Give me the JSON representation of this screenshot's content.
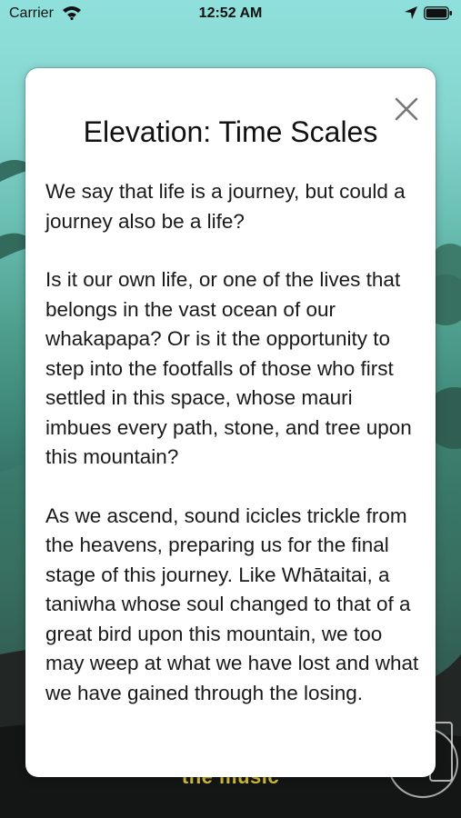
{
  "status_bar": {
    "carrier": "Carrier",
    "time": "12:52 AM",
    "icons": [
      "wifi-icon",
      "location-arrow-icon",
      "battery-icon"
    ]
  },
  "background": {
    "caption": "the music",
    "caption_color": "#d9c23a"
  },
  "modal": {
    "title": "Elevation: Time Scales",
    "close_icon": "close-icon",
    "paragraphs": [
      "We say that life is a journey, but could a journey also be a life?",
      "Is it our own life, or one of the lives that belongs in the vast ocean of our whakapapa? Or is it the opportunity to step into the footfalls of those who first settled in this space, whose mauri imbues every path, stone, and tree upon this mountain?",
      "As we ascend, sound icicles trickle from the heavens, preparing us for the final stage of this journey. Like Whātaitai, a taniwha whose soul changed to that of a great bird upon this mountain, we too may weep at what we have lost and what we have gained through the losing."
    ]
  }
}
